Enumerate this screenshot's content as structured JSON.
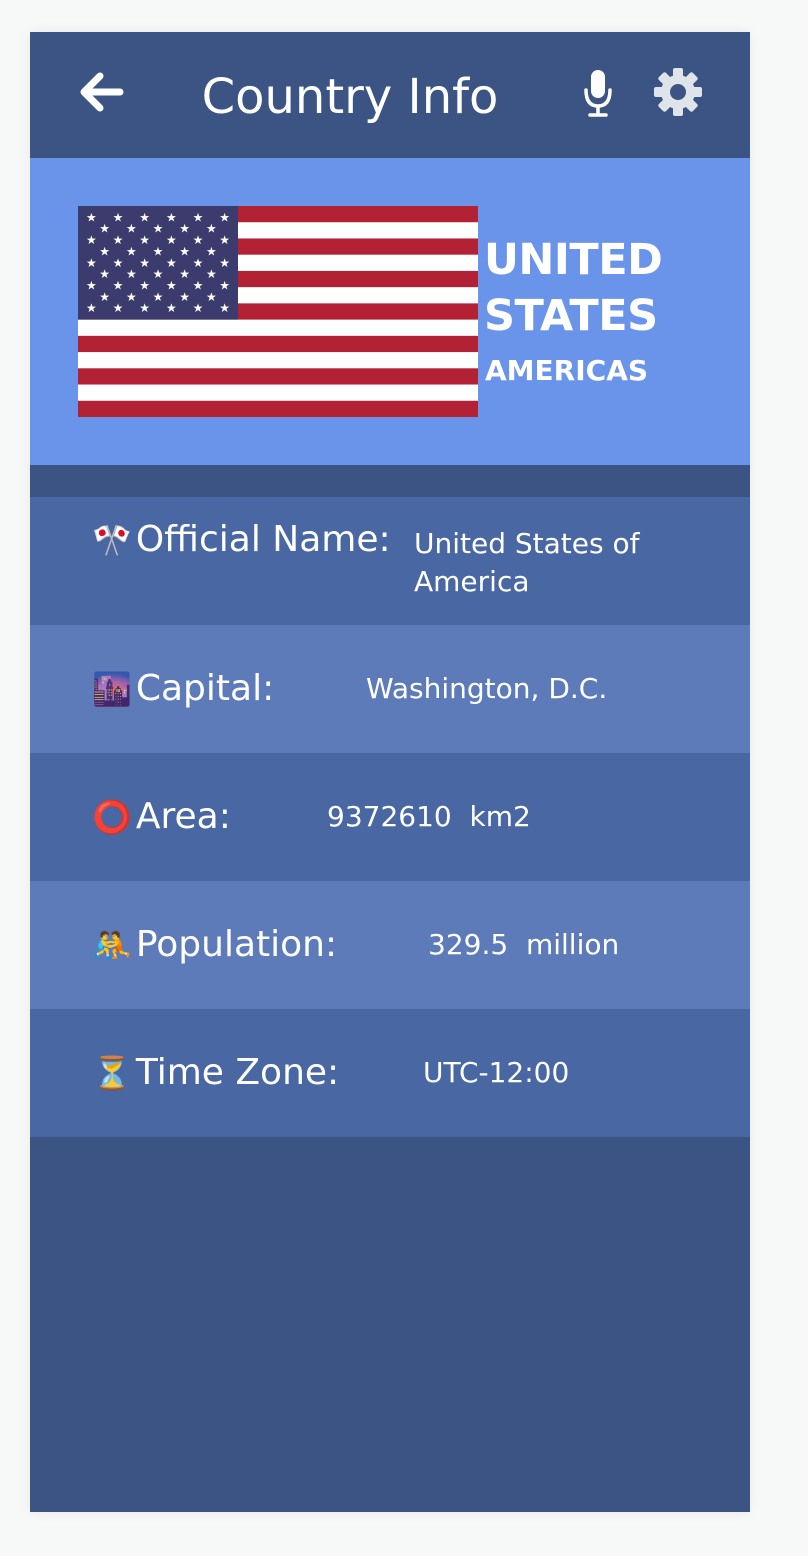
{
  "appbar": {
    "title": "Country Info",
    "back_icon": "arrow-left-icon",
    "mic_icon": "microphone-icon",
    "settings_icon": "gear-icon"
  },
  "country": {
    "name": "UNITED STATES",
    "region": "AMERICAS",
    "flag": "us-flag"
  },
  "info": {
    "official_name": {
      "emoji": "🎌",
      "label": "Official Name:",
      "value": "United States of America"
    },
    "capital": {
      "emoji": "🌆",
      "label": "Capital:",
      "value": "Washington, D.C."
    },
    "area": {
      "emoji": "⭕",
      "label": "Area:",
      "value": "9372610  km2"
    },
    "population": {
      "emoji": "🤼",
      "label": "Population:",
      "value": "329.5  million"
    },
    "time_zone": {
      "emoji": "⏳",
      "label": "Time Zone:",
      "value": "UTC-12:00"
    }
  },
  "colors": {
    "appbar": "#3b5484",
    "hero": "#6a94e9",
    "row_dark": "#4967a3",
    "row_light": "#5d7bb9",
    "flag_red": "#b22234",
    "flag_blue": "#3c3b6e"
  }
}
